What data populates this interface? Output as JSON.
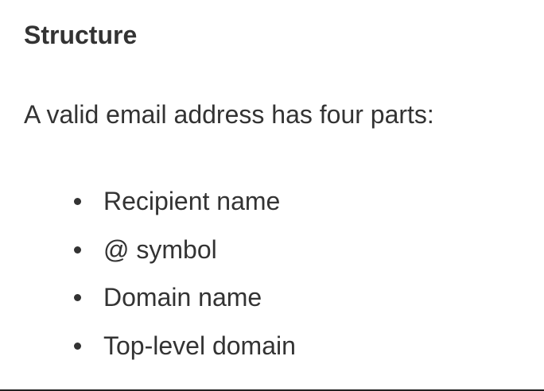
{
  "section": {
    "heading": "Structure",
    "intro": "A valid email address has four parts:",
    "parts": [
      "Recipient name",
      "@ symbol",
      "Domain name",
      "Top-level domain"
    ]
  }
}
